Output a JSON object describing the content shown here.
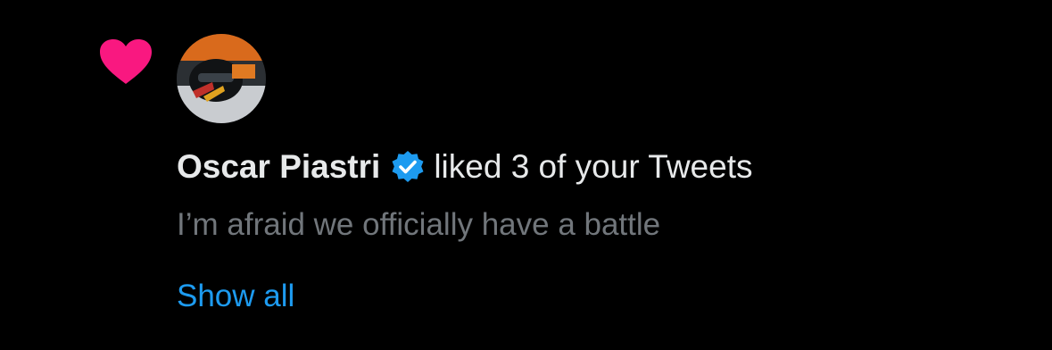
{
  "notification": {
    "icon": "heart-icon",
    "icon_color": "#f91880",
    "user": {
      "name": "Oscar Piastri",
      "verified": true,
      "verified_icon": "verified-badge-icon",
      "verified_color": "#1d9bf0"
    },
    "action_text": "liked 3 of your Tweets",
    "tweet_preview": "I’m afraid we officially have a battle",
    "show_all_label": "Show all"
  },
  "colors": {
    "background": "#000000",
    "primary_text": "#e7e9ea",
    "secondary_text": "#71767b",
    "link": "#1d9bf0"
  }
}
